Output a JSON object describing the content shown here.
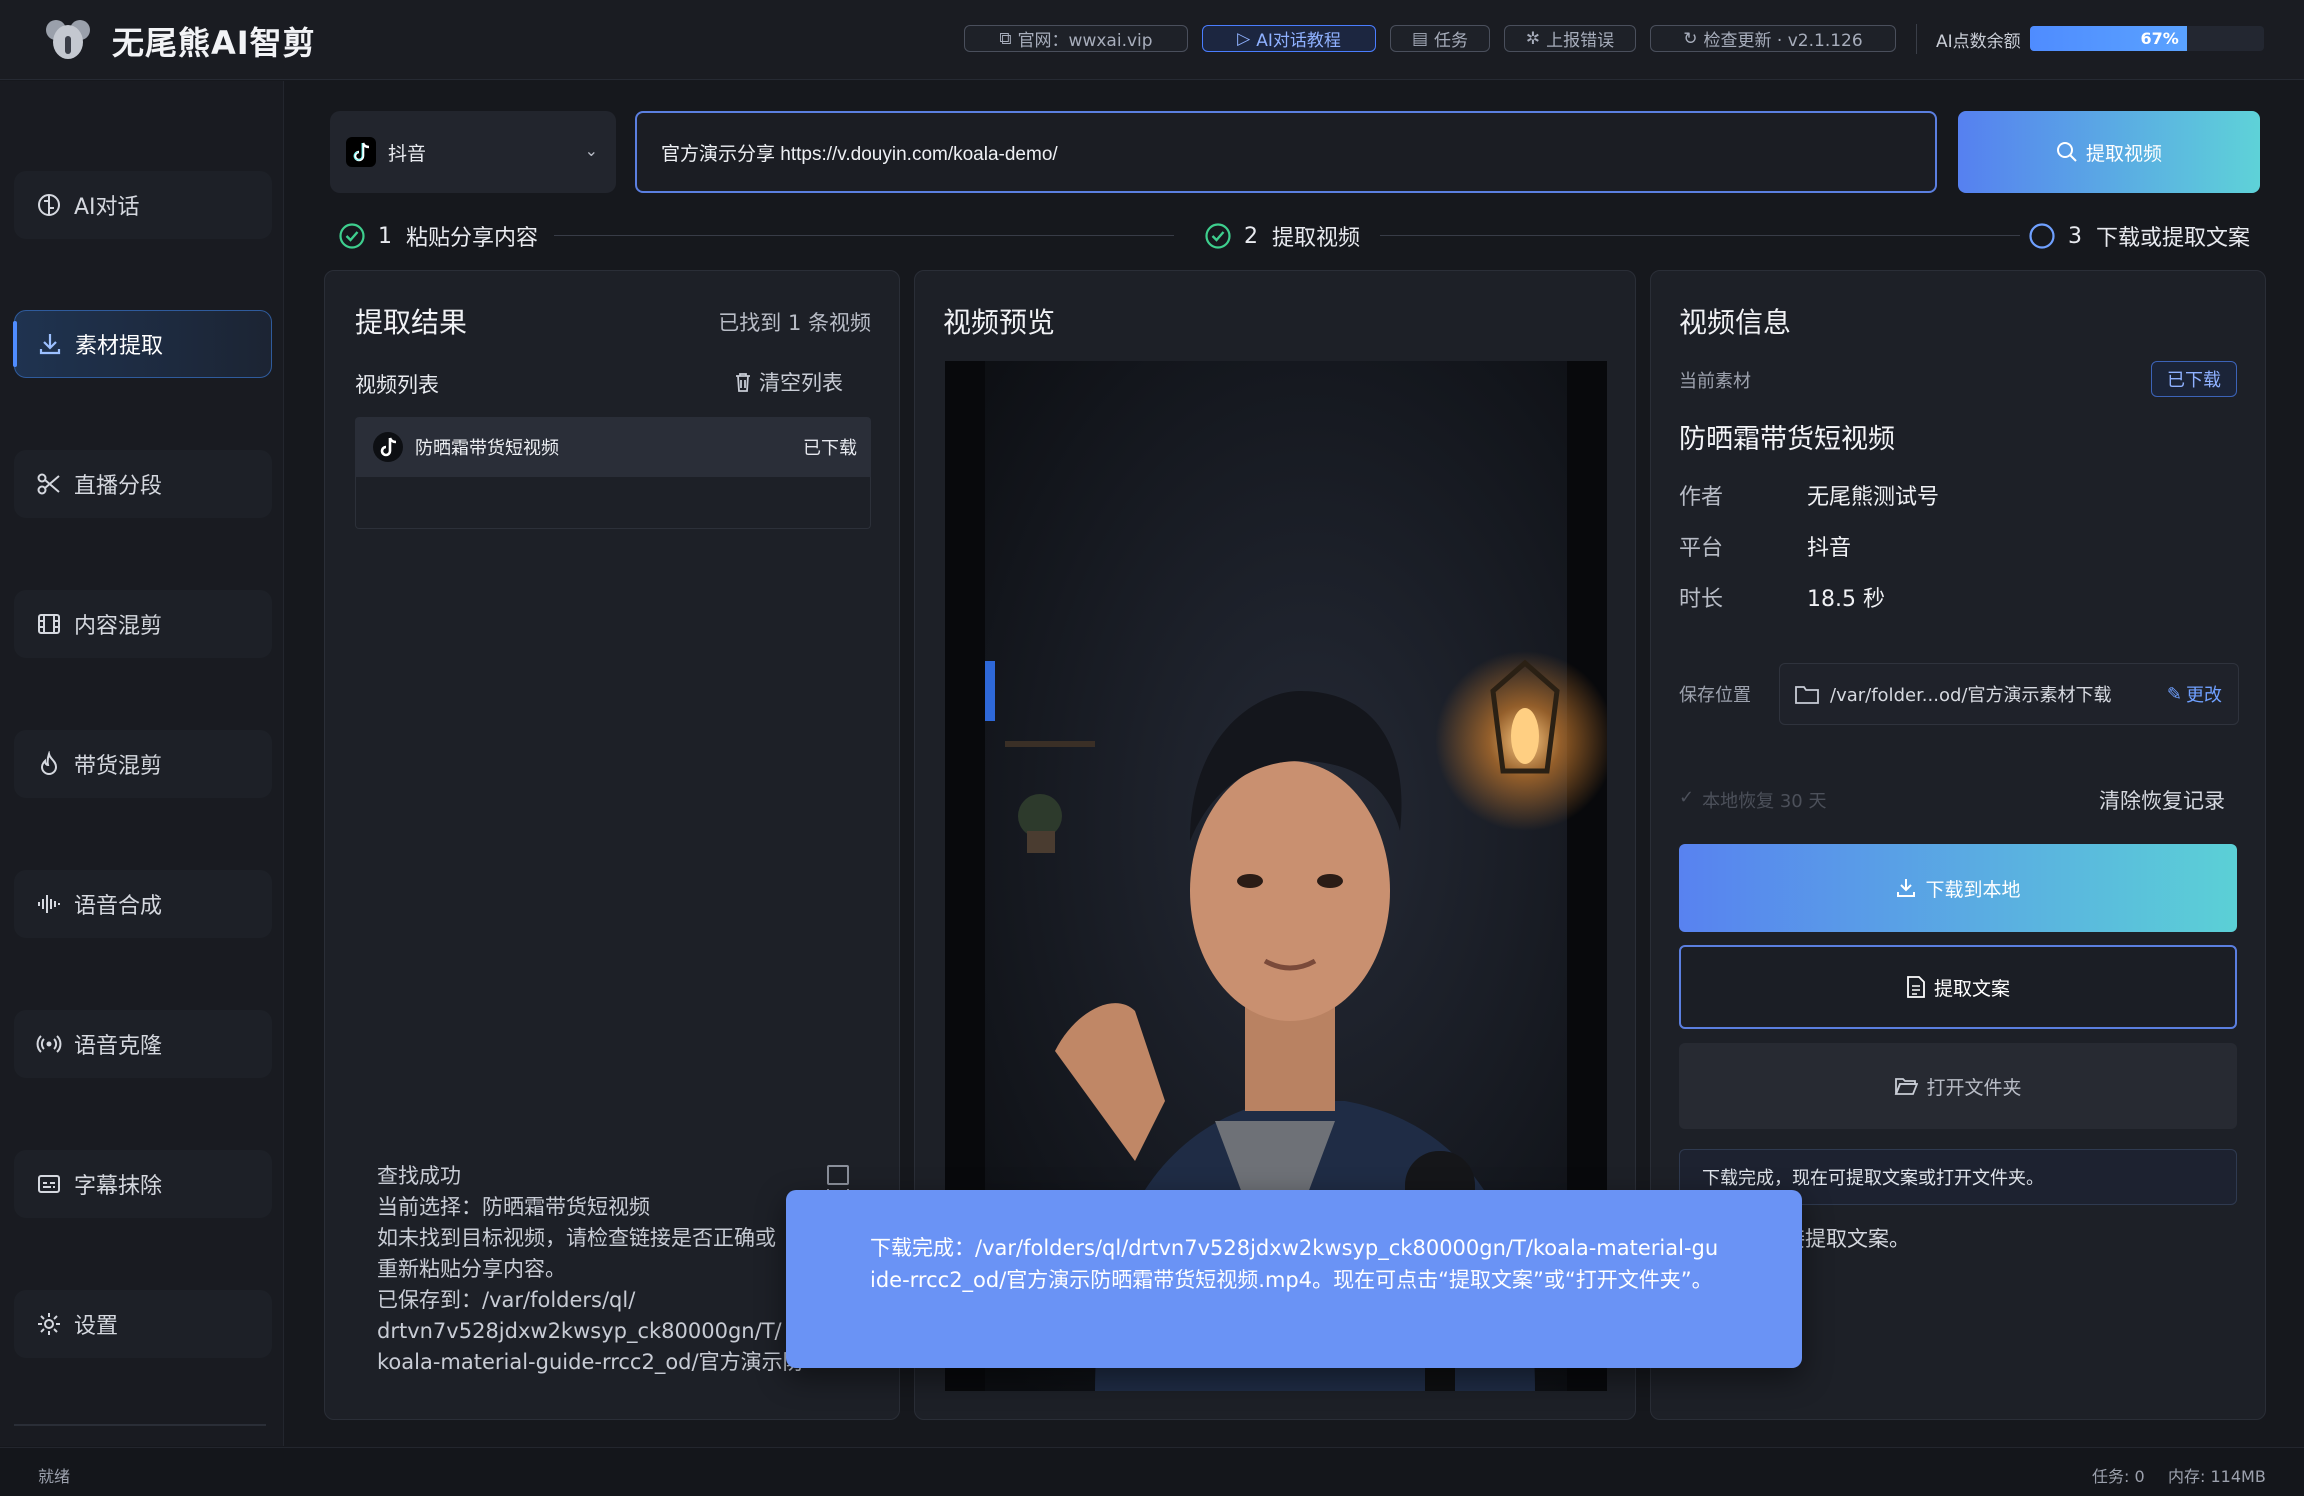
{
  "app": {
    "title": "无尾熊AI智剪"
  },
  "header": {
    "links": [
      {
        "icon": "external-link-icon",
        "label": "官网：wwxai.vip"
      },
      {
        "icon": "play-icon",
        "label": "AI对话教程"
      },
      {
        "icon": "task-icon",
        "label": "任务"
      },
      {
        "icon": "bug-icon",
        "label": "上报错误"
      },
      {
        "icon": "refresh-icon",
        "label": "检查更新 · v2.1.126"
      }
    ],
    "quota_label": "AI点数余额",
    "quota_percent_text": "67%",
    "quota_fraction": 0.67
  },
  "sidebar": {
    "items": [
      {
        "icon": "brain-icon",
        "label": "AI对话"
      },
      {
        "icon": "download-icon",
        "label": "素材提取",
        "active": true
      },
      {
        "icon": "scissors-icon",
        "label": "直播分段"
      },
      {
        "icon": "film-icon",
        "label": "内容混剪"
      },
      {
        "icon": "flame-icon",
        "label": "带货混剪"
      },
      {
        "icon": "waveform-icon",
        "label": "语音合成"
      },
      {
        "icon": "broadcast-icon",
        "label": "语音克隆"
      },
      {
        "icon": "subtitle-icon",
        "label": "字幕抹除"
      },
      {
        "icon": "gear-icon",
        "label": "设置"
      }
    ]
  },
  "input": {
    "platform": "抖音",
    "url_value": "官方演示分享 https://v.douyin.com/koala-demo/",
    "fetch_button": "提取视频"
  },
  "steps": [
    {
      "num": "1",
      "label": "粘贴分享内容",
      "done": true
    },
    {
      "num": "2",
      "label": "提取视频",
      "done": true
    },
    {
      "num": "3",
      "label": "下载或提取文案",
      "done": false
    }
  ],
  "results": {
    "title": "提取结果",
    "found": "已找到 1 条视频",
    "list_label": "视频列表",
    "clear_label": "清空列表",
    "items": [
      {
        "title": "防晒霜带货短视频",
        "status": "已下载"
      }
    ],
    "log": "查找成功\n当前选择：防晒霜带货短视频\n如未找到目标视频，请检查链接是否正确或\n重新粘贴分享内容。\n已保存到：/var/folders/ql/\ndrtvn7v528jdxw2kwsyp_ck80000gn/T/\nkoala-material-guide-rrcc2_od/官方演示防"
  },
  "preview": {
    "title": "视频预览"
  },
  "info": {
    "title": "视频信息",
    "current_label": "当前素材",
    "badge": "已下载",
    "video_title": "防晒霜带货短视频",
    "author_k": "作者",
    "author_v": "无尾熊测试号",
    "platform_k": "平台",
    "platform_v": "抖音",
    "duration_k": "时长",
    "duration_v": "18.5 秒",
    "save_k": "保存位置",
    "save_path": "/var/folder...od/官方演示素材下载",
    "change": "更改",
    "restore": "本地恢复 30 天",
    "clear_restore": "清除恢复记录",
    "download_btn": "下载到本地",
    "extract_btn": "提取文案",
    "open_btn": "打开文件夹",
    "status_msg": "下载完成，现在可提取文案或打开文件夹。",
    "ready_msg": "就绪，可直接提取文案。"
  },
  "toast": {
    "message": "下载完成：/var/folders/ql/drtvn7v528jdxw2kwsyp_ck80000gn/T/koala-material-guide-rrcc2_od/官方演示防晒霜带货短视频.mp4。现在可点击“提取文案”或“打开文件夹”。"
  },
  "statusbar": {
    "left": "就绪",
    "tasks": "任务: 0",
    "memory": "内存: 114MB"
  },
  "colors": {
    "accent": "#4f8cff",
    "success": "#3ecf8e",
    "toast": "#6a93f5"
  }
}
